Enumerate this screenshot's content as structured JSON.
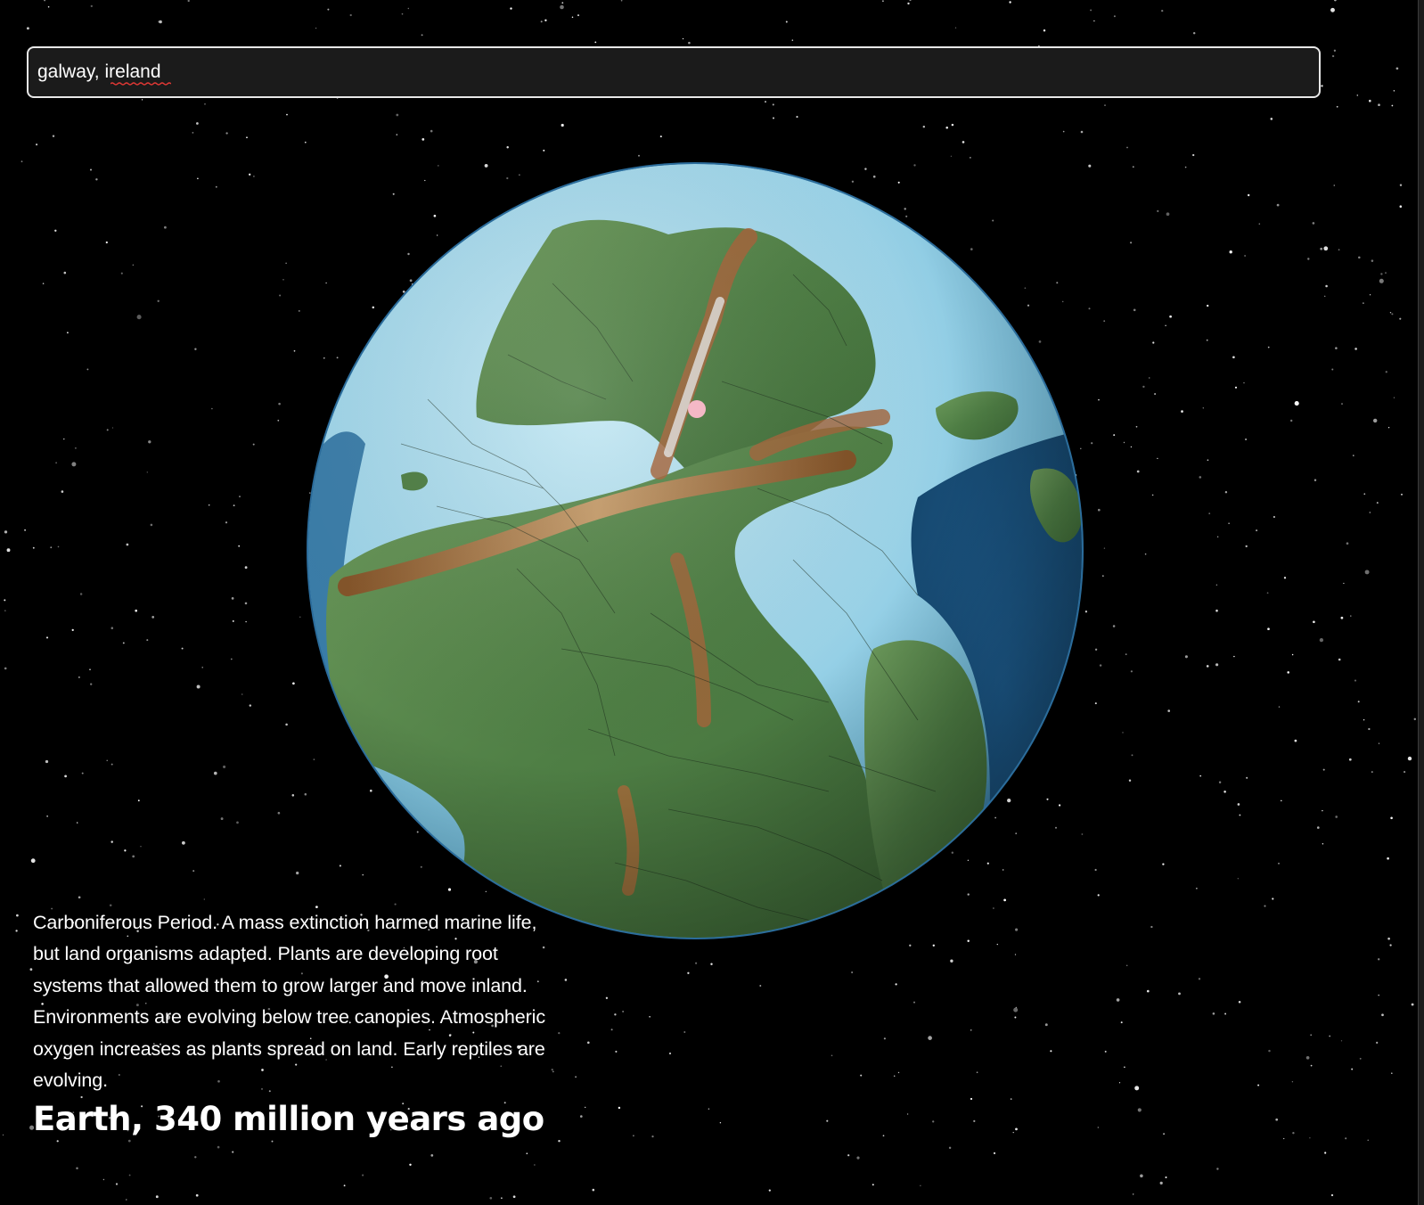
{
  "search": {
    "value": "galway, ireland",
    "misspelled_word": "ireland"
  },
  "globe": {
    "marker_location": "galway, ireland",
    "marker_color": "#f4b8c6",
    "ocean_deep_color": "#1f5f92",
    "ocean_shallow_color": "#9fd6ea",
    "land_color": "#4e7f45",
    "mountain_color": "#b06a3a"
  },
  "description": {
    "text": "Carboniferous Period. A mass extinction harmed marine life, but land organisms adapted. Plants are developing root systems that allowed them to grow larger and move inland. Environments are evolving below tree canopies. Atmospheric oxygen increases as plants spread on land. Early reptiles are evolving."
  },
  "title": {
    "text": "Earth, 340 million years ago"
  }
}
